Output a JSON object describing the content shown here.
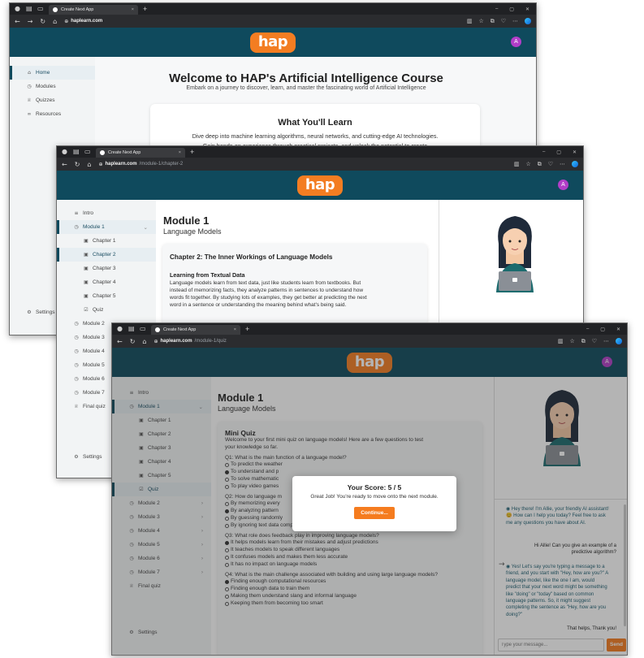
{
  "browser": {
    "tab_title": "Create Next App",
    "host": "haplearn.com",
    "path1": "",
    "path2": "/module-1/chapter-2",
    "path3": "/module-1/quiz"
  },
  "app": {
    "logo": "hap",
    "avatar_initial": "A"
  },
  "win1": {
    "sidebar": [
      {
        "label": "Home",
        "icon": "home-icon"
      },
      {
        "label": "Modules",
        "icon": "clock-icon"
      },
      {
        "label": "Quizzes",
        "icon": "trophy-icon"
      },
      {
        "label": "Resources",
        "icon": "link-icon"
      }
    ],
    "settings": "Settings",
    "title": "Welcome to HAP's Artificial Intelligence Course",
    "subtitle": "Embark on a journey to discover, learn, and master the fascinating world of Artificial Intelligence",
    "card_title": "What You'll Learn",
    "card_line1": "Dive deep into machine learning algorithms, neural networks, and cutting-edge AI technologies.",
    "card_line2": "Gain hands-on experience through practical projects, and unlock the potential to create"
  },
  "win2": {
    "sidebar_top": [
      {
        "label": "Intro"
      },
      {
        "label": "Module 1"
      }
    ],
    "chapters": [
      "Chapter 1",
      "Chapter 2",
      "Chapter 3",
      "Chapter 4",
      "Chapter 5"
    ],
    "quiz": "Quiz",
    "modules": [
      "Module 2",
      "Module 3",
      "Module 4",
      "Module 5",
      "Module 6",
      "Module 7"
    ],
    "final_quiz": "Final quiz",
    "settings": "Settings",
    "module_title": "Module 1",
    "module_subtitle": "Language Models",
    "chapter_title": "Chapter 2: The Inner Workings of Language Models",
    "section_title": "Learning from Textual Data",
    "para_lines": [
      "Language models learn from text data, just like students learn from textbooks. But",
      "instead of memorizing facts, they analyze patterns in sentences to understand how",
      "words fit together. By studying lots of examples, they get better at predicting the next",
      "word in a sentence or understanding the meaning behind what's being said."
    ]
  },
  "win3": {
    "module_title": "Module 1",
    "module_subtitle": "Language Models",
    "quiz_title": "Mini Quiz",
    "quiz_intro_lines": [
      "Welcome to your first mini quiz on language models! Here are a few questions to test",
      "your knowledge so far."
    ],
    "questions": [
      {
        "q": "Q1: What is the main function of a language model?",
        "options": [
          "To predict the weather",
          "To understand and p",
          "To solve mathematic",
          "To play video games"
        ],
        "selected": 1
      },
      {
        "q": "Q2: How do language m",
        "options": [
          "By memorizing every",
          "By analyzing pattern",
          "By guessing randomly",
          "By ignoring text data completely"
        ],
        "selected": 1
      },
      {
        "q": "Q3: What role does feedback play in improving language models?",
        "options": [
          "It helps models learn from their mistakes and adjust predictions",
          "It teaches models to speak different languages",
          "It confuses models and makes them less accurate",
          "It has no impact on language models"
        ],
        "selected": 0
      },
      {
        "q": "Q4: What is the main challenge associated with building and using large language models?",
        "options": [
          "Finding enough computational resources",
          "Finding enough data to train them",
          "Making them understand slang and informal language",
          "Keeping them from becoming too smart"
        ],
        "selected": 0
      }
    ],
    "modal": {
      "score": "Your Score: 5 / 5",
      "message": "Great Job! You're ready to move onto the next module.",
      "button": "Continue..."
    },
    "chat": {
      "messages": [
        {
          "from": "bot",
          "text": "Hey there! I'm Allie, your friendly AI assistant! 😊 How can I help you today? Feel free to ask me any questions you have about AI."
        },
        {
          "from": "user",
          "text": "Hi Allie! Can you give an example of a predictive algorithm?"
        },
        {
          "from": "bot",
          "text": "Yes! Let's say you're typing a message to a friend, and you start with \"Hey, how are you?\" A language model, like the one I am, would predict that your next word might be something like \"doing\" or \"today\" based on common language patterns. So, it might suggest completing the sentence as \"Hey, how are you doing?\""
        },
        {
          "from": "user",
          "text": "That helps, Thank you!"
        }
      ],
      "placeholder": "Type your message...",
      "send": "Send"
    }
  },
  "colors": {
    "header": "#0f4a5d",
    "accent": "#f57c1f",
    "avatar": "#b23ec8"
  }
}
